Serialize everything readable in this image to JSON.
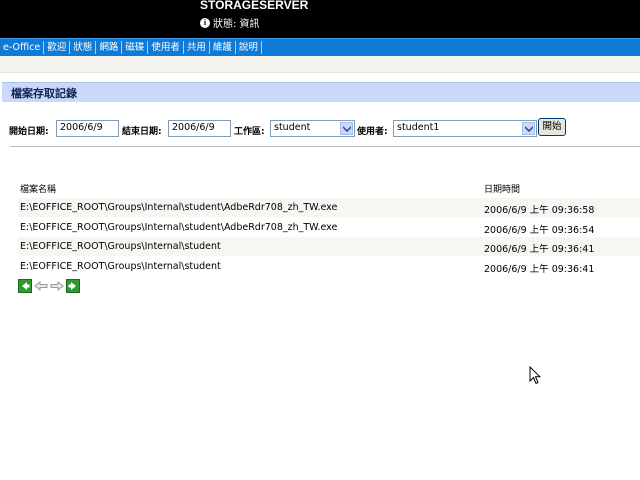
{
  "header": {
    "server_name": "STORAGESERVER",
    "status": "狀態: 資訊"
  },
  "nav": {
    "items": [
      "e-Office",
      "歡迎",
      "狀態",
      "網路",
      "磁碟",
      "使用者",
      "共用",
      "維護",
      "說明"
    ]
  },
  "section": {
    "title": "檔案存取記錄"
  },
  "filters": {
    "start_label": "開始日期:",
    "start_value": "2006/6/9",
    "end_label": "結束日期:",
    "end_value": "2006/6/9",
    "workspace_label": "工作區:",
    "workspace_value": "student",
    "user_label": "使用者:",
    "user_value": "student1",
    "open_button": "開始"
  },
  "table": {
    "columns": [
      "檔案名稱",
      "日期時間"
    ],
    "rows": [
      {
        "path": "E:\\EOFFICE_ROOT\\Groups\\Internal\\student\\AdbeRdr708_zh_TW.exe",
        "time": "2006/6/9 上午 09:36:58"
      },
      {
        "path": "E:\\EOFFICE_ROOT\\Groups\\Internal\\student\\AdbeRdr708_zh_TW.exe",
        "time": "2006/6/9 上午 09:36:54"
      },
      {
        "path": "E:\\EOFFICE_ROOT\\Groups\\Internal\\student",
        "time": "2006/6/9 上午 09:36:41"
      },
      {
        "path": "E:\\EOFFICE_ROOT\\Groups\\Internal\\student",
        "time": "2006/6/9 上午 09:36:41"
      }
    ]
  },
  "pager": {
    "icons": [
      "first-page-icon",
      "prev-page-icon",
      "next-page-icon",
      "last-page-icon"
    ]
  },
  "colors": {
    "nav_bg": "#0f7bd7",
    "section_bg": "#c9d9f7",
    "pager_green": "#2f9a2f"
  }
}
